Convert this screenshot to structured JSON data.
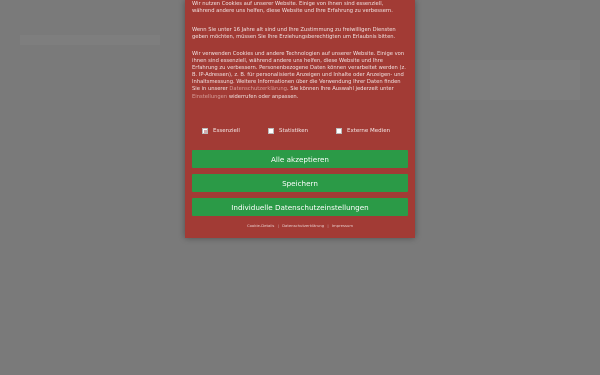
{
  "consent": {
    "para1": "Wir nutzen Cookies auf unserer Website. Einige von ihnen sind essenziell, während andere uns helfen, diese Website und Ihre Erfahrung zu verbessern.",
    "para2": "Wenn Sie unter 16 Jahre alt sind und Ihre Zustimmung zu freiwilligen Diensten geben möchten, müssen Sie Ihre Erziehungsberechtigten um Erlaubnis bitten.",
    "para3_a": "Wir verwenden Cookies und andere Technologien auf unserer Website. Einige von ihnen sind essenziell, während andere uns helfen, diese Website und Ihre Erfahrung zu verbessern. Personenbezogene Daten können verarbeitet werden (z. B. IP-Adressen), z. B. für personalisierte Anzeigen und Inhalte oder Anzeigen- und Inhaltsmessung. Weitere Informationen über die Verwendung Ihrer Daten finden Sie in unserer ",
    "privacy_link": "Datenschutzerklärung",
    "para3_b": ". Sie können Ihre Auswahl jederzeit unter ",
    "settings_link": "Einstellungen",
    "para3_c": " widerrufen oder anpassen.",
    "checkboxes": [
      {
        "label": "Essenziell",
        "checked": true
      },
      {
        "label": "Statistiken",
        "checked": false
      },
      {
        "label": "Externe Medien",
        "checked": false
      }
    ],
    "buttons": {
      "accept_all": "Alle akzeptieren",
      "save": "Speichern",
      "individual": "Individuelle Datenschutzeinstellungen"
    },
    "footer": {
      "cookie_details": "Cookie-Details",
      "privacy": "Datenschutzerklärung",
      "imprint": "Impressum",
      "separator": "|"
    }
  },
  "colors": {
    "modal_bg": "#a23b35",
    "button_bg": "#2b9a47",
    "overlay": "#7a7a7a"
  }
}
